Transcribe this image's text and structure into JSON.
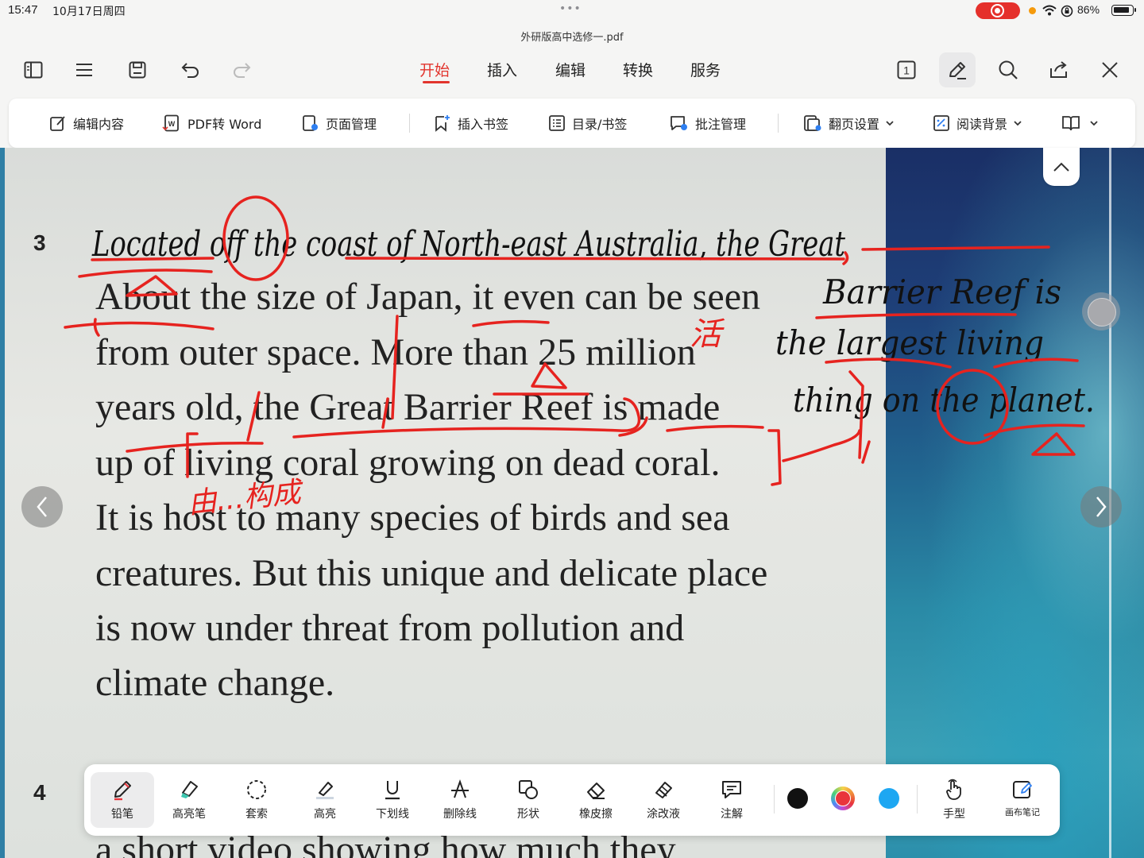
{
  "status": {
    "time": "15:47",
    "date": "10月17日周四",
    "dots": "•••",
    "battery": "86%"
  },
  "document": {
    "title": "外研版高中选修一.pdf"
  },
  "main_tabs": [
    {
      "label": "开始",
      "active": true
    },
    {
      "label": "插入"
    },
    {
      "label": "编辑"
    },
    {
      "label": "转换"
    },
    {
      "label": "服务"
    }
  ],
  "page_indicator": "1",
  "ribbon": {
    "edit_content": "编辑内容",
    "pdf_to_word": "PDF转 Word",
    "page_manage": "页面管理",
    "insert_bookmark": "插入书签",
    "toc_bookmark": "目录/书签",
    "comment_manage": "批注管理",
    "page_turn": "翻页设置",
    "read_bg": "阅读背景"
  },
  "page": {
    "para3_number": "3",
    "para4_number": "4",
    "lines": [
      "About the size of Japan, it even can be seen",
      "from outer space. More than 25 million",
      "years old, the Great Barrier Reef is made",
      "up of living coral growing on dead coral.",
      "It is host to many species of birds and sea",
      "creatures. But this unique and delicate place",
      "is now under threat from pollution and",
      "climate change.",
      "a short video showing how much they"
    ],
    "handwriting": {
      "line1": "Located off the coast of North-east Australia, the Great",
      "line2": "Barrier Reef is",
      "line3": "the largest living",
      "line4": "thing on the planet.",
      "red_note_1": "活",
      "red_note_2": "由...构成"
    }
  },
  "annotation_tools": [
    {
      "label": "铅笔",
      "icon": "pencil-icon"
    },
    {
      "label": "高亮笔",
      "icon": "highlighter-icon"
    },
    {
      "label": "套索",
      "icon": "lasso-icon"
    },
    {
      "label": "高亮",
      "icon": "highlight-icon"
    },
    {
      "label": "下划线",
      "icon": "underline-icon"
    },
    {
      "label": "删除线",
      "icon": "strikethrough-icon"
    },
    {
      "label": "形状",
      "icon": "shape-icon"
    },
    {
      "label": "橡皮擦",
      "icon": "eraser-icon"
    },
    {
      "label": "涂改液",
      "icon": "correction-fluid-icon"
    },
    {
      "label": "注解",
      "icon": "comment-icon"
    }
  ],
  "colors": {
    "black": "#111111",
    "red": "#e9353b",
    "blue": "#1ea7f2",
    "accent": "#e2342d"
  },
  "hand_mode": "手型",
  "canvas_note": "画布笔记"
}
